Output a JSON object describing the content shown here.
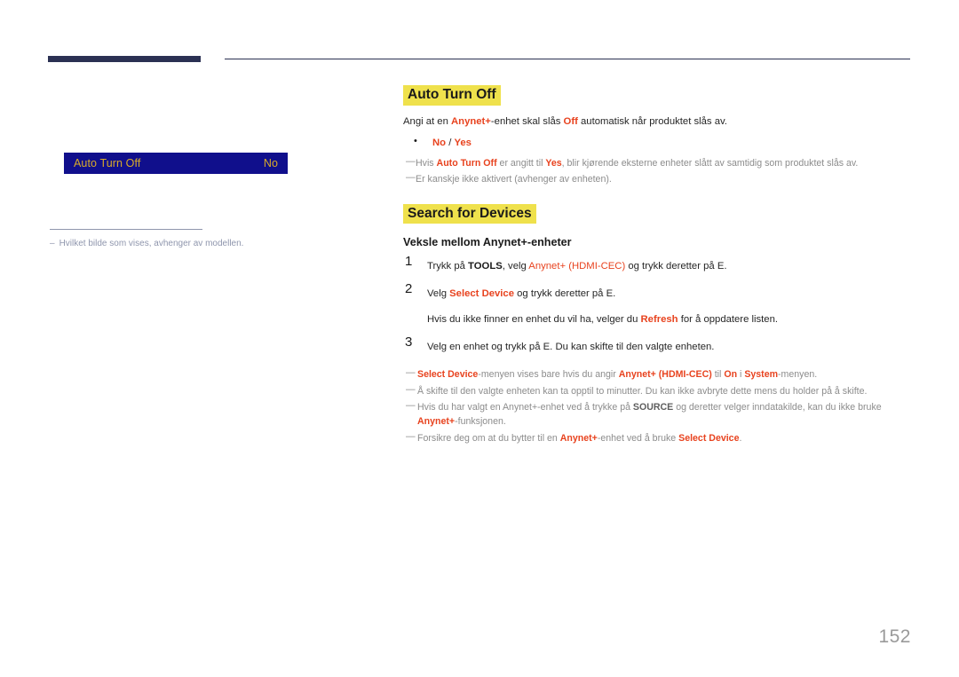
{
  "page": {
    "number": "152"
  },
  "left_panel": {
    "osd_menu": {
      "label": "Auto Turn Off",
      "value": "No",
      "bg_color": "#100f8c",
      "text_color": "#d9ab2a"
    },
    "footnote": {
      "dash": "–",
      "text": "Hvilket bilde som vises, avhenger av modellen."
    }
  },
  "content": {
    "section1": {
      "heading": "Auto Turn Off",
      "highlight_color": "#efe14c",
      "intro": {
        "pre": "Angi at en ",
        "kw1": "Anynet+",
        "mid": "-enhet skal slås ",
        "kw2": "Off",
        "post": " automatisk når produktet slås av."
      },
      "options": {
        "opt1": "No",
        "separator": " / ",
        "opt2": "Yes"
      },
      "notes": [
        {
          "dash": "—",
          "p1": "Hvis ",
          "k1": "Auto Turn Off",
          "p2": " er angitt til ",
          "k2": "Yes",
          "p3": ", blir kjørende eksterne enheter slått av samtidig som produktet slås av."
        },
        {
          "dash": "—",
          "p1": "Er kanskje ikke aktivert (avhenger av enheten).",
          "k1": "",
          "p2": "",
          "k2": "",
          "p3": ""
        }
      ]
    },
    "section2": {
      "heading": "Search for Devices",
      "highlight_color": "#efe14c",
      "subheading": "Veksle mellom Anynet+-enheter",
      "steps": [
        {
          "num": "1",
          "pre": "Trykk på ",
          "bold1": "TOOLS",
          "mid": ", velg ",
          "kw": "Anynet+ (HDMI-CEC)",
          "post": " og trykk deretter på E."
        },
        {
          "num": "2",
          "pre": "Velg ",
          "bold1": "",
          "mid": "",
          "kw": "Select Device",
          "post": " og trykk deretter på E.",
          "sub_pre": "Hvis du ikke finner en enhet du vil ha, velger du ",
          "sub_kw": "Refresh",
          "sub_post": " for å oppdatere listen."
        },
        {
          "num": "3",
          "pre": "Velg en enhet og trykk på E. Du kan skifte til den valgte enheten.",
          "bold1": "",
          "mid": "",
          "kw": "",
          "post": ""
        }
      ],
      "notes": [
        {
          "dash": "—",
          "p1": "",
          "k1": "Select Device",
          "p2": "-menyen vises bare hvis du angir ",
          "k2": "Anynet+ (HDMI-CEC)",
          "p3": " til ",
          "k3": "On",
          "p4": " i ",
          "k4": "System",
          "p5": "-menyen."
        },
        {
          "dash": "—",
          "p1": "Å skifte til den valgte enheten kan ta opptil to minutter. Du kan ikke avbryte dette mens du holder på å skifte.",
          "k1": "",
          "p2": "",
          "k2": "",
          "p3": "",
          "k3": "",
          "p4": "",
          "k4": "",
          "p5": ""
        },
        {
          "dash": "—",
          "p1": "Hvis du har valgt en Anynet+-enhet ved å trykke på ",
          "k1": "SOURCE",
          "p2": " og deretter velger inndatakilde, kan du ikke bruke ",
          "k2": "Anynet+",
          "p3": "-funksjonen.",
          "k3": "",
          "p4": "",
          "k4": "",
          "p5": ""
        },
        {
          "dash": "—",
          "p1": "Forsikre deg om at du bytter til en ",
          "k1": "Anynet+",
          "p2": "-enhet ved å bruke ",
          "k2": "Select Device",
          "p3": ".",
          "k3": "",
          "p4": "",
          "k4": "",
          "p5": ""
        }
      ]
    }
  }
}
